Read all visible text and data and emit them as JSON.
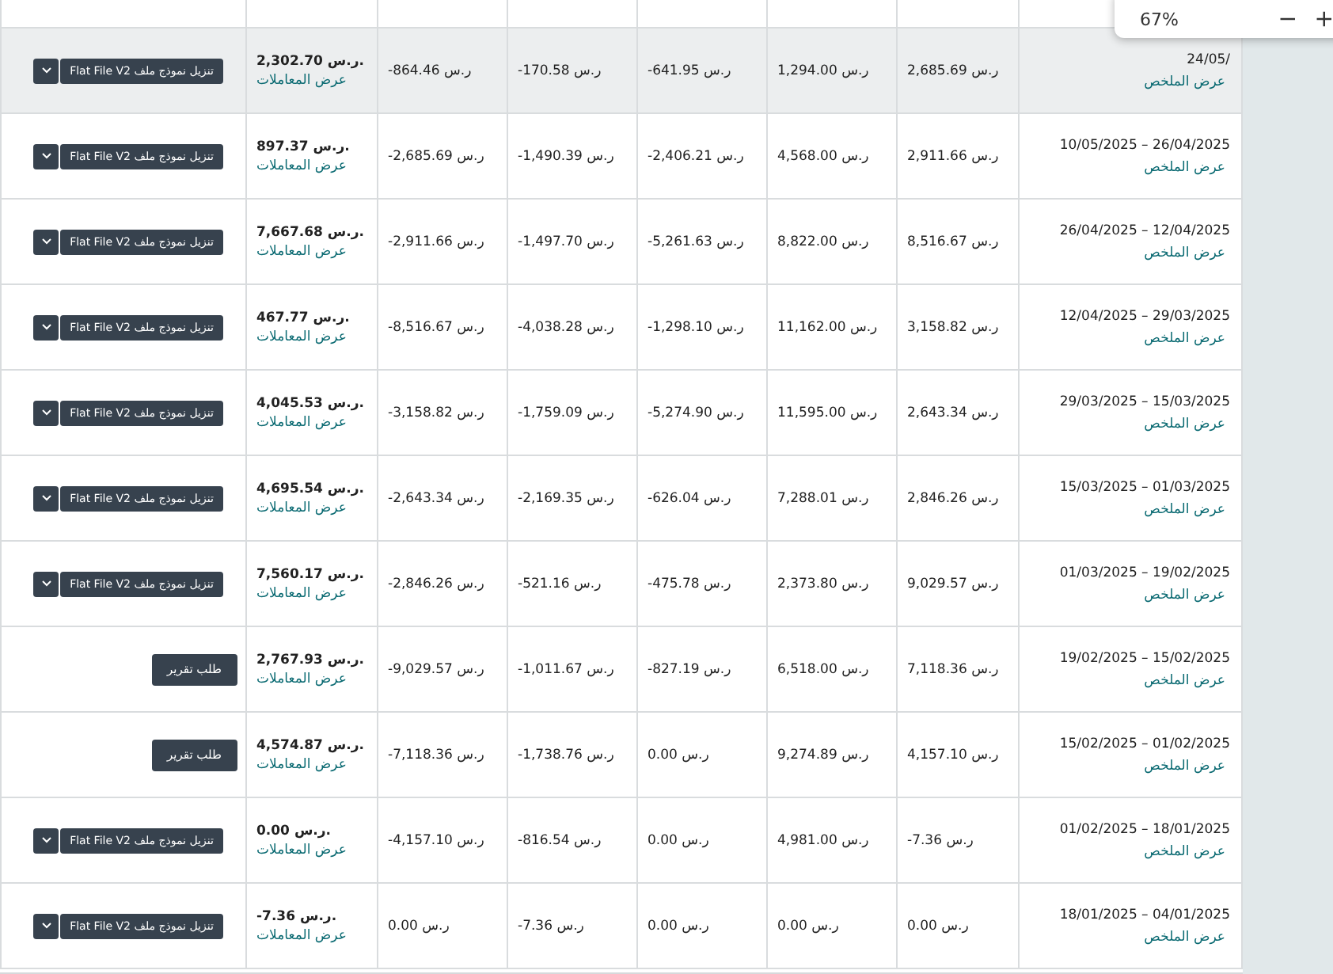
{
  "zoom_popup": {
    "value": "67%"
  },
  "rows": [
    {
      "selected": true,
      "date": "24/05/",
      "summary_link": "عرض الملخص",
      "values": [
        "2,685.69 ر.س",
        "1,294.00 ر.س",
        "-641.95 ر.س",
        "-170.58 ر.س",
        "-864.46 ر.س"
      ],
      "total": "2,302.70 ر.س.",
      "transactions_link": "عرض المعاملات",
      "action": {
        "kind": "download",
        "label": "تنزيل نموذج ملف Flat File V2"
      }
    },
    {
      "selected": false,
      "date": "10/05/2025 – 26/04/2025",
      "summary_link": "عرض الملخص",
      "values": [
        "2,911.66 ر.س",
        "4,568.00 ر.س",
        "-2,406.21 ر.س",
        "-1,490.39 ر.س",
        "-2,685.69 ر.س"
      ],
      "total": "897.37 ر.س.",
      "transactions_link": "عرض المعاملات",
      "action": {
        "kind": "download",
        "label": "تنزيل نموذج ملف Flat File V2"
      }
    },
    {
      "selected": false,
      "date": "26/04/2025 – 12/04/2025",
      "summary_link": "عرض الملخص",
      "values": [
        "8,516.67 ر.س",
        "8,822.00 ر.س",
        "-5,261.63 ر.س",
        "-1,497.70 ر.س",
        "-2,911.66 ر.س"
      ],
      "total": "7,667.68 ر.س.",
      "transactions_link": "عرض المعاملات",
      "action": {
        "kind": "download",
        "label": "تنزيل نموذج ملف Flat File V2"
      }
    },
    {
      "selected": false,
      "date": "12/04/2025 – 29/03/2025",
      "summary_link": "عرض الملخص",
      "values": [
        "3,158.82 ر.س",
        "11,162.00 ر.س",
        "-1,298.10 ر.س",
        "-4,038.28 ر.س",
        "-8,516.67 ر.س"
      ],
      "total": "467.77 ر.س.",
      "transactions_link": "عرض المعاملات",
      "action": {
        "kind": "download",
        "label": "تنزيل نموذج ملف Flat File V2"
      }
    },
    {
      "selected": false,
      "date": "29/03/2025 – 15/03/2025",
      "summary_link": "عرض الملخص",
      "values": [
        "2,643.34 ر.س",
        "11,595.00 ر.س",
        "-5,274.90 ر.س",
        "-1,759.09 ر.س",
        "-3,158.82 ر.س"
      ],
      "total": "4,045.53 ر.س.",
      "transactions_link": "عرض المعاملات",
      "action": {
        "kind": "download",
        "label": "تنزيل نموذج ملف Flat File V2"
      }
    },
    {
      "selected": false,
      "date": "15/03/2025 – 01/03/2025",
      "summary_link": "عرض الملخص",
      "values": [
        "2,846.26 ر.س",
        "7,288.01 ر.س",
        "-626.04 ر.س",
        "-2,169.35 ر.س",
        "-2,643.34 ر.س"
      ],
      "total": "4,695.54 ر.س.",
      "transactions_link": "عرض المعاملات",
      "action": {
        "kind": "download",
        "label": "تنزيل نموذج ملف Flat File V2"
      }
    },
    {
      "selected": false,
      "date": "01/03/2025 – 19/02/2025",
      "summary_link": "عرض الملخص",
      "values": [
        "9,029.57 ر.س",
        "2,373.80 ر.س",
        "-475.78 ر.س",
        "-521.16 ر.س",
        "-2,846.26 ر.س"
      ],
      "total": "7,560.17 ر.س.",
      "transactions_link": "عرض المعاملات",
      "action": {
        "kind": "download",
        "label": "تنزيل نموذج ملف Flat File V2"
      }
    },
    {
      "selected": false,
      "date": "19/02/2025 – 15/02/2025",
      "summary_link": "عرض الملخص",
      "values": [
        "7,118.36 ر.س",
        "6,518.00 ر.س",
        "-827.19 ر.س",
        "-1,011.67 ر.س",
        "-9,029.57 ر.س"
      ],
      "total": "2,767.93 ر.س.",
      "transactions_link": "عرض المعاملات",
      "action": {
        "kind": "request",
        "label": "طلب تقرير"
      }
    },
    {
      "selected": false,
      "date": "15/02/2025 – 01/02/2025",
      "summary_link": "عرض الملخص",
      "values": [
        "4,157.10 ر.س",
        "9,274.89 ر.س",
        "0.00 ر.س",
        "-1,738.76 ر.س",
        "-7,118.36 ر.س"
      ],
      "total": "4,574.87 ر.س.",
      "transactions_link": "عرض المعاملات",
      "action": {
        "kind": "request",
        "label": "طلب تقرير"
      }
    },
    {
      "selected": false,
      "date": "01/02/2025 – 18/01/2025",
      "summary_link": "عرض الملخص",
      "values": [
        "-7.36 ر.س",
        "4,981.00 ر.س",
        "0.00 ر.س",
        "-816.54 ر.س",
        "-4,157.10 ر.س"
      ],
      "total": "0.00 ر.س.",
      "transactions_link": "عرض المعاملات",
      "action": {
        "kind": "download",
        "label": "تنزيل نموذج ملف Flat File V2"
      }
    },
    {
      "selected": false,
      "date": "18/01/2025 – 04/01/2025",
      "summary_link": "عرض الملخص",
      "values": [
        "0.00 ر.س",
        "0.00 ر.س",
        "0.00 ر.س",
        "-7.36 ر.س",
        "0.00 ر.س"
      ],
      "total": "-7.36 ر.س.",
      "transactions_link": "عرض المعاملات",
      "action": {
        "kind": "download",
        "label": "تنزيل نموذج ملف Flat File V2"
      }
    }
  ]
}
